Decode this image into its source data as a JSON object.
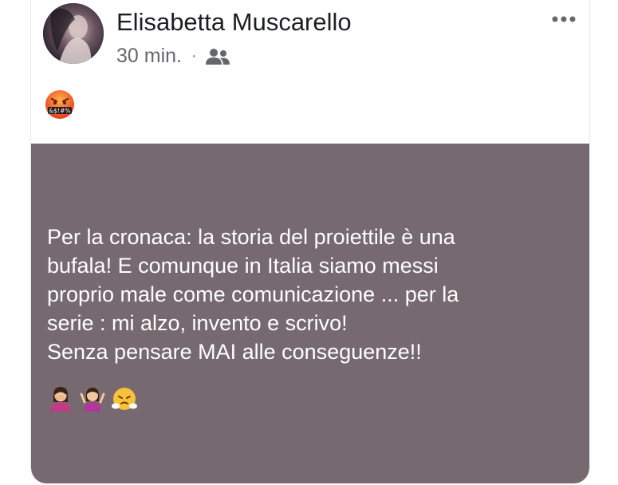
{
  "post": {
    "author_name": "Elisabetta Muscarello",
    "time": "30 min.",
    "separator": "·",
    "audience_icon": "friends-icon",
    "more_icon": "more-options-icon",
    "reaction_emoji": "angry-face-with-symbols-emoji",
    "body_lines": [
      "Per la cronaca: la storia del proiettile è una",
      "bufala! E comunque in Italia siamo messi",
      "proprio male come comunicazione ... per la",
      "serie : mi alzo, invento e scrivo!",
      "Senza pensare MAI alle conseguenze!!"
    ],
    "trailing_emojis": [
      "woman-facepalming-emoji",
      "woman-shrugging-emoji",
      "face-with-steam-emoji"
    ],
    "background_color": "#76696f"
  }
}
